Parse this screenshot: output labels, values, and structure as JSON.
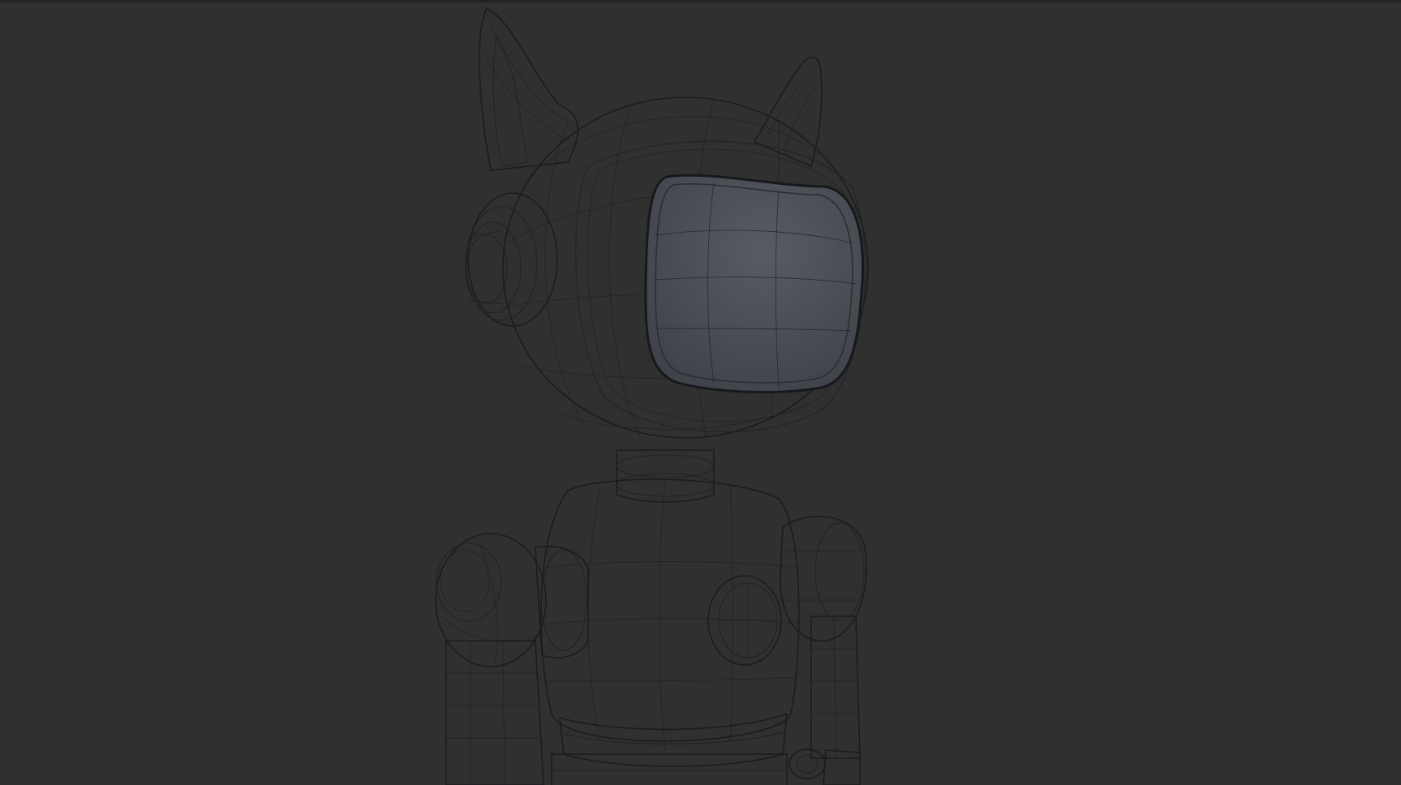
{
  "viewport": {
    "background_color": "#303030",
    "model_color": "#5a5f66",
    "wire_color": "#1d2024"
  },
  "model": {
    "subject": "robot-cat",
    "display_mode": "shaded-wireframe"
  }
}
